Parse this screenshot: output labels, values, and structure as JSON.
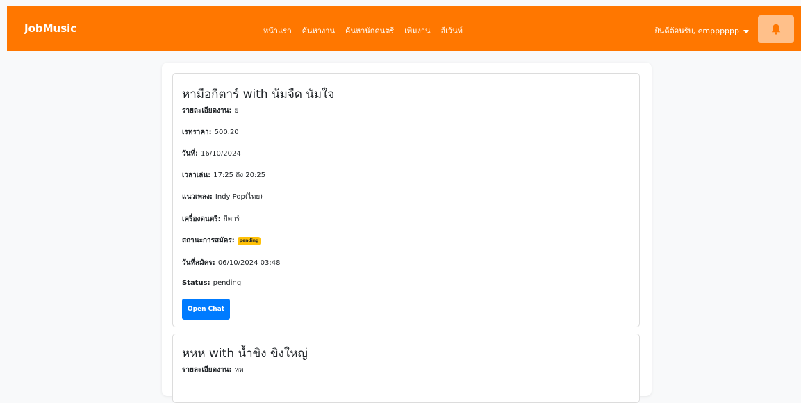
{
  "app": {
    "brand": "JobMusic"
  },
  "nav": {
    "links": [
      "หน้าแรก",
      "ค้นหางาน",
      "ค้นหานักดนตรี",
      "เพิ่มงาน",
      "อีเว้นท์"
    ],
    "user_greeting": "ยินดีต้อนรับ, empppppp",
    "notification_icon": "bell-icon"
  },
  "cards": [
    {
      "title": "หามือกีตาร์ with น้มจืด นัมใจ",
      "fields": [
        {
          "label": "รายละเอียดงาน:",
          "value": "ย"
        },
        {
          "label": "เรทราคา:",
          "value": "500.20"
        },
        {
          "label": "วันที่:",
          "value": "16/10/2024"
        },
        {
          "label": "เวลาเล่น:",
          "value": "17:25 ถึง 20:25"
        },
        {
          "label": "แนวเพลง:",
          "value": "Indy Pop(ไทย)"
        },
        {
          "label": "เครื่องดนตรี:",
          "value": "กีตาร์"
        },
        {
          "label": "สถานะการสมัคร:",
          "badge": "pending"
        },
        {
          "label": "วันที่สมัคร:",
          "value": "06/10/2024 03:48"
        },
        {
          "label": "Status:",
          "value": "pending"
        }
      ],
      "button": "Open Chat"
    },
    {
      "title": "หหห with น้ำขิง ขิงใหญ่",
      "fields": [
        {
          "label": "รายละเอียดงาน:",
          "value": "หห"
        }
      ]
    }
  ],
  "colors": {
    "navbar": "#ff7700",
    "badge": "#ffc107",
    "button": "#007bff",
    "bell_button": "#ffc08a",
    "bell_icon": "#ff7700"
  }
}
